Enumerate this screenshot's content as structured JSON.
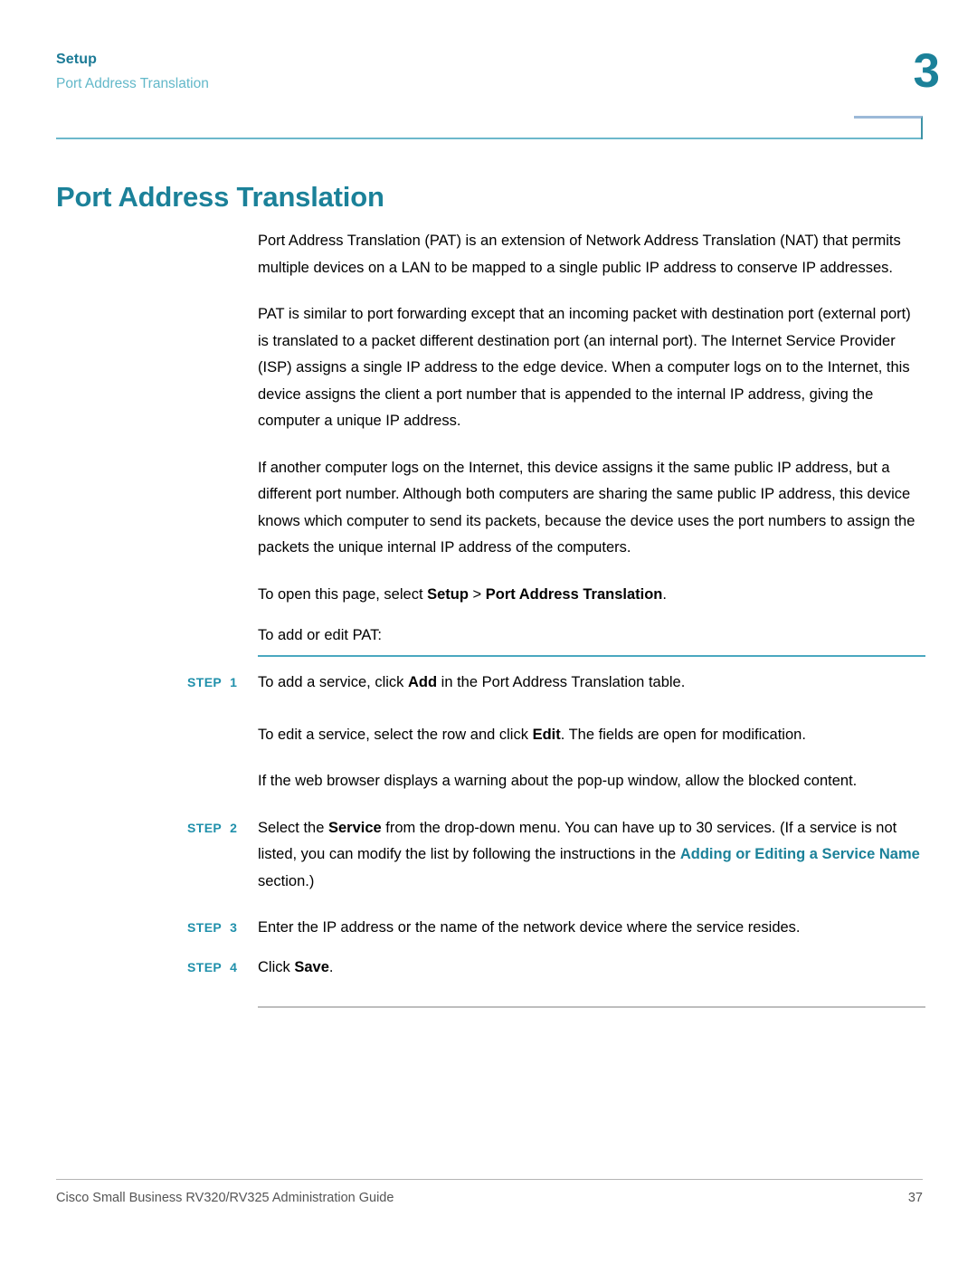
{
  "colors": {
    "accent_teal": "#1b8199",
    "accent_teal_light": "#62b8c9",
    "rule_teal": "#4aa8c0",
    "rule_gray": "#bdbdbd",
    "step_label": "#2090ab",
    "body_text": "#000000",
    "footer_text": "#555555"
  },
  "running_header": {
    "chapter_name": "Setup",
    "section_name": "Port Address Translation",
    "chapter_number": "3"
  },
  "page_title": "Port Address Translation",
  "paragraphs": [
    {
      "id": "intro",
      "text": "Port Address Translation (PAT) is an extension of Network Address Translation (NAT) that permits multiple devices on a LAN to be mapped to a single public IP address to conserve IP addresses."
    },
    {
      "id": "how-it-works",
      "text": "PAT is similar to port forwarding except that an incoming packet with destination port (external port) is translated to a packet different destination port (an internal port). The Internet Service Provider (ISP) assigns a single IP address to the edge device. When a computer logs on to the Internet, this device assigns the client a port number that is appended to the internal IP address, giving the computer a unique IP address."
    },
    {
      "id": "multiple-computers",
      "text": "If another computer logs on the Internet, this device assigns it the same public IP address, but a different port number. Although both computers are sharing the same public IP address, this device knows which computer to send its packets, because the device uses the port numbers to assign the packets the unique internal IP address of the computers."
    }
  ],
  "navigation_line": {
    "prefix": "To open this page, select ",
    "menu": "Setup",
    "separator": " > ",
    "submenu": "Port Address Translation",
    "suffix": "."
  },
  "intro_to_steps": "To add or edit PAT:",
  "steps": [
    {
      "label": "STEP",
      "number": "1",
      "text_before": "To add a service, click ",
      "bold": "Add",
      "text_after": " in the Port Address Translation table."
    },
    {
      "label": "STEP",
      "number": "2",
      "text_before": "Select the ",
      "bold": "Service",
      "text_after": " from the drop-down menu. You can have up to 30 services. (If a service is not listed, you can modify the list by following the instructions in the ",
      "xref": "Adding or Editing a Service Name",
      "text_end": " section.)"
    },
    {
      "label": "STEP",
      "number": "3",
      "text_before": "Enter the IP address or the name of the network device where the service resides.",
      "bold": "",
      "text_after": ""
    },
    {
      "label": "STEP",
      "number": "4",
      "text_before": "Click ",
      "bold": "Save",
      "text_after": "."
    }
  ],
  "step1_notes": [
    {
      "text_before": "To edit a service, select the row and click ",
      "bold": "Edit",
      "text_after": ". The fields are open for modification."
    },
    {
      "text_before": "If the web browser displays a warning about the pop-up window, allow the blocked content.",
      "bold": "",
      "text_after": ""
    }
  ],
  "footer": {
    "guide_title": "Cisco Small Business RV320/RV325 Administration Guide",
    "page_number": "37"
  }
}
